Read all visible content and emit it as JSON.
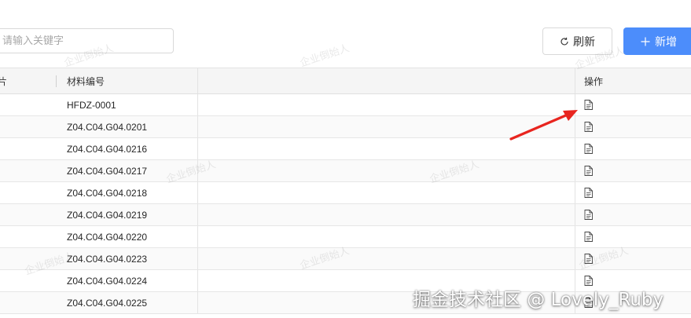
{
  "toolbar": {
    "search_placeholder": "请输入关键字",
    "search_value": "",
    "refresh_label": "刷新",
    "add_label": "新增",
    "primary_color": "#4c8dfb"
  },
  "table": {
    "columns": [
      {
        "label": "片"
      },
      {
        "label": "材料编号"
      },
      {
        "label": ""
      },
      {
        "label": "操作"
      }
    ],
    "rows": [
      {
        "code": "HFDZ-0001",
        "action_icon": "document-icon"
      },
      {
        "code": "Z04.C04.G04.0201",
        "action_icon": "document-icon"
      },
      {
        "code": "Z04.C04.G04.0216",
        "action_icon": "document-icon"
      },
      {
        "code": "Z04.C04.G04.0217",
        "action_icon": "document-icon"
      },
      {
        "code": "Z04.C04.G04.0218",
        "action_icon": "document-icon"
      },
      {
        "code": "Z04.C04.G04.0219",
        "action_icon": "document-icon"
      },
      {
        "code": "Z04.C04.G04.0220",
        "action_icon": "document-icon"
      },
      {
        "code": "Z04.C04.G04.0223",
        "action_icon": "document-icon"
      },
      {
        "code": "Z04.C04.G04.0224",
        "action_icon": "document-icon"
      },
      {
        "code": "Z04.C04.G04.0225",
        "action_icon": "document-icon"
      }
    ]
  },
  "annotation": {
    "arrow_color": "#e8251f"
  },
  "watermark": {
    "text": "企业倒始人"
  },
  "credit": {
    "text": "掘金技术社区 @ Lovely_Ruby"
  }
}
